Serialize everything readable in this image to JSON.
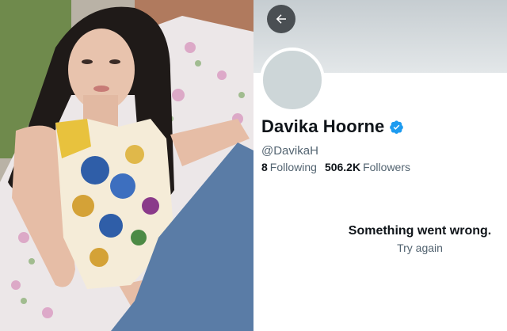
{
  "photo": {
    "description_icon": "portrait-photo"
  },
  "profile": {
    "back_icon": "arrow-left-icon",
    "display_name": "Davika Hoorne",
    "verified_icon": "verified-badge-icon",
    "handle": "@DavikaH",
    "following_count": "8",
    "following_label": "Following",
    "followers_count": "506.2K",
    "followers_label": "Followers",
    "error_message": "Something went wrong.",
    "retry_label": "Try again"
  },
  "colors": {
    "banner": "#c6cdd1",
    "avatar": "#cdd6d8",
    "verified": "#1d9bf0",
    "text_primary": "#0f1419",
    "text_secondary": "#536471"
  }
}
